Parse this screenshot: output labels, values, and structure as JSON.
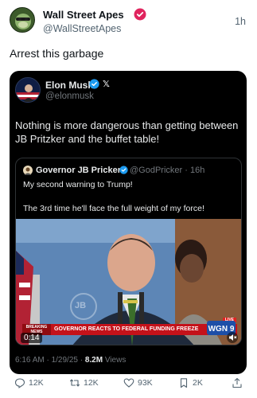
{
  "post": {
    "display_name": "Wall Street Apes",
    "handle": "@WallStreetApes",
    "time_ago": "1h",
    "text": "Arrest this garbage"
  },
  "embedded": {
    "display_name": "Elon Musk",
    "handle": "@elonmusk",
    "text": "Nothing is more dangerous than getting between JB Pritzker and the buffet table!",
    "quote": {
      "display_name": "Governor JB Pricker",
      "handle_time": "@GodPricker · 16h",
      "line1": "My second warning to Trump!",
      "line2": "The 3rd time he'll face the full weight of my force!"
    },
    "video": {
      "breaking_label": "BREAKING NEWS",
      "headline": "GOVERNOR REACTS TO FEDERAL FUNDING FREEZE",
      "station": "WGN 9",
      "live_label": "LIVE",
      "elapsed": "0:14",
      "watermark": "JB"
    },
    "meta": {
      "timestamp": "6:16 AM · 1/29/25 · ",
      "views_count": "8.2M",
      "views_label": " Views"
    }
  },
  "actions": {
    "replies": "12K",
    "reposts": "12K",
    "likes": "93K",
    "bookmarks": "2K"
  },
  "colors": {
    "verified_red": "#e0245e",
    "verified_blue": "#1d9bf0",
    "news_red": "#c4121a"
  }
}
